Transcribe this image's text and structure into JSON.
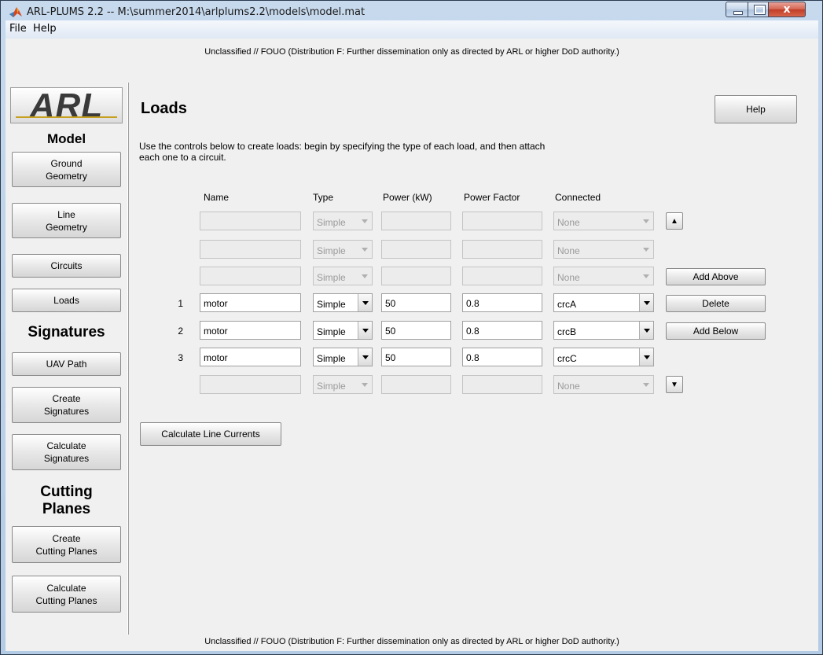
{
  "window": {
    "title": "ARL-PLUMS 2.2 -- M:\\summer2014\\arlplums2.2\\models\\model.mat",
    "close_glyph": "x"
  },
  "menu": [
    "File",
    "Help"
  ],
  "notice": "Unclassified // FOUO (Distribution F: Further dissemination only as directed by ARL or higher DoD authority.)",
  "sidebar": {
    "logo": "ARL",
    "sections": {
      "model": "Model",
      "signatures": "Signatures",
      "cutting_planes": "Cutting\nPlanes"
    },
    "buttons": {
      "ground_geometry": "Ground\nGeometry",
      "line_geometry": "Line\nGeometry",
      "circuits": "Circuits",
      "loads": "Loads",
      "uav_path": "UAV Path",
      "create_signatures": "Create\nSignatures",
      "calculate_signatures": "Calculate\nSignatures",
      "create_cutting_planes": "Create\nCutting Planes",
      "calculate_cutting_planes": "Calculate\nCutting Planes"
    }
  },
  "main": {
    "title": "Loads",
    "help_label": "Help",
    "instructions": "Use the controls below to create loads: begin by specifying the type of each load, and then attach each one to a circuit.",
    "columns": {
      "name": "Name",
      "type": "Type",
      "power": "Power (kW)",
      "power_factor": "Power Factor",
      "connected": "Connected"
    },
    "rows": [
      {
        "num": "",
        "name": "",
        "type": "Simple",
        "power": "",
        "pf": "",
        "connected": "None"
      },
      {
        "num": "",
        "name": "",
        "type": "Simple",
        "power": "",
        "pf": "",
        "connected": "None"
      },
      {
        "num": "",
        "name": "",
        "type": "Simple",
        "power": "",
        "pf": "",
        "connected": "None"
      },
      {
        "num": "1",
        "name": "motor",
        "type": "Simple",
        "power": "50",
        "pf": "0.8",
        "connected": "crcA"
      },
      {
        "num": "2",
        "name": "motor",
        "type": "Simple",
        "power": "50",
        "pf": "0.8",
        "connected": "crcB"
      },
      {
        "num": "3",
        "name": "motor",
        "type": "Simple",
        "power": "50",
        "pf": "0.8",
        "connected": "crcC"
      },
      {
        "num": "",
        "name": "",
        "type": "Simple",
        "power": "",
        "pf": "",
        "connected": "None"
      }
    ],
    "add_above_label": "Add Above",
    "delete_label": "Delete",
    "add_below_label": "Add Below",
    "scroll_up_glyph": "▲",
    "scroll_down_glyph": "▼",
    "calc_label": "Calculate Line Currents"
  }
}
